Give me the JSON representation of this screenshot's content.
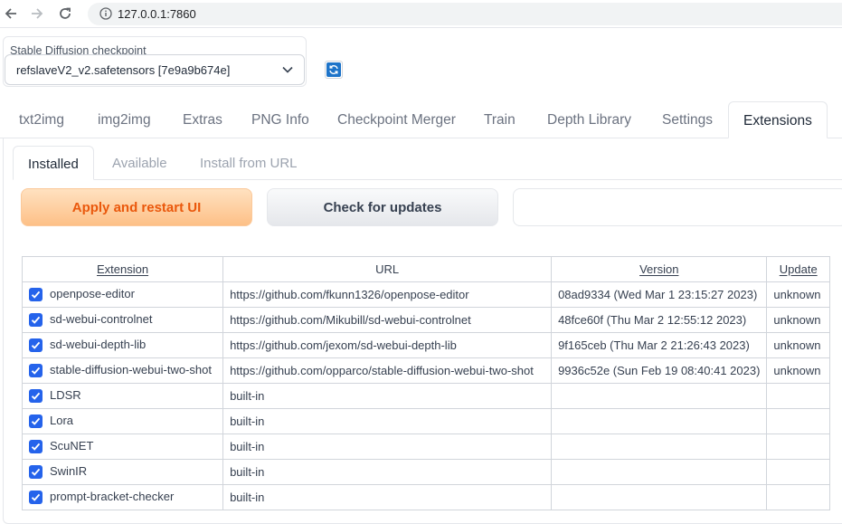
{
  "browser": {
    "url": "127.0.0.1:7860"
  },
  "checkpoint": {
    "label": "Stable Diffusion checkpoint",
    "value": "refslaveV2_v2.safetensors [7e9a9b674e]"
  },
  "main_tabs": [
    {
      "label": "txt2img"
    },
    {
      "label": "img2img"
    },
    {
      "label": "Extras"
    },
    {
      "label": "PNG Info"
    },
    {
      "label": "Checkpoint Merger"
    },
    {
      "label": "Train"
    },
    {
      "label": "Depth Library"
    },
    {
      "label": "Settings"
    },
    {
      "label": "Extensions",
      "active": true
    }
  ],
  "sub_tabs": [
    {
      "label": "Installed",
      "active": true
    },
    {
      "label": "Available"
    },
    {
      "label": "Install from URL"
    }
  ],
  "buttons": {
    "apply": "Apply and restart UI",
    "check": "Check for updates"
  },
  "table": {
    "headers": {
      "extension": "Extension",
      "url": "URL",
      "version": "Version",
      "update": "Update"
    },
    "rows": [
      {
        "name": "openpose-editor",
        "url": "https://github.com/fkunn1326/openpose-editor",
        "version": "08ad9334 (Wed Mar 1 23:15:27 2023)",
        "update": "unknown",
        "checked": true
      },
      {
        "name": "sd-webui-controlnet",
        "url": "https://github.com/Mikubill/sd-webui-controlnet",
        "version": "48fce60f (Thu Mar 2 12:55:12 2023)",
        "update": "unknown",
        "checked": true
      },
      {
        "name": "sd-webui-depth-lib",
        "url": "https://github.com/jexom/sd-webui-depth-lib",
        "version": "9f165ceb (Thu Mar 2 21:26:43 2023)",
        "update": "unknown",
        "checked": true
      },
      {
        "name": "stable-diffusion-webui-two-shot",
        "url": "https://github.com/opparco/stable-diffusion-webui-two-shot",
        "version": "9936c52e (Sun Feb 19 08:40:41 2023)",
        "update": "unknown",
        "checked": true
      },
      {
        "name": "LDSR",
        "url": "built-in",
        "version": "",
        "update": "",
        "checked": true
      },
      {
        "name": "Lora",
        "url": "built-in",
        "version": "",
        "update": "",
        "checked": true
      },
      {
        "name": "ScuNET",
        "url": "built-in",
        "version": "",
        "update": "",
        "checked": true
      },
      {
        "name": "SwinIR",
        "url": "built-in",
        "version": "",
        "update": "",
        "checked": true
      },
      {
        "name": "prompt-bracket-checker",
        "url": "built-in",
        "version": "",
        "update": "",
        "checked": true
      }
    ]
  },
  "colors": {
    "checkbox": "#2563eb",
    "apply_text": "#ea580c",
    "refresh_icon_bg": "#1e74c9"
  }
}
